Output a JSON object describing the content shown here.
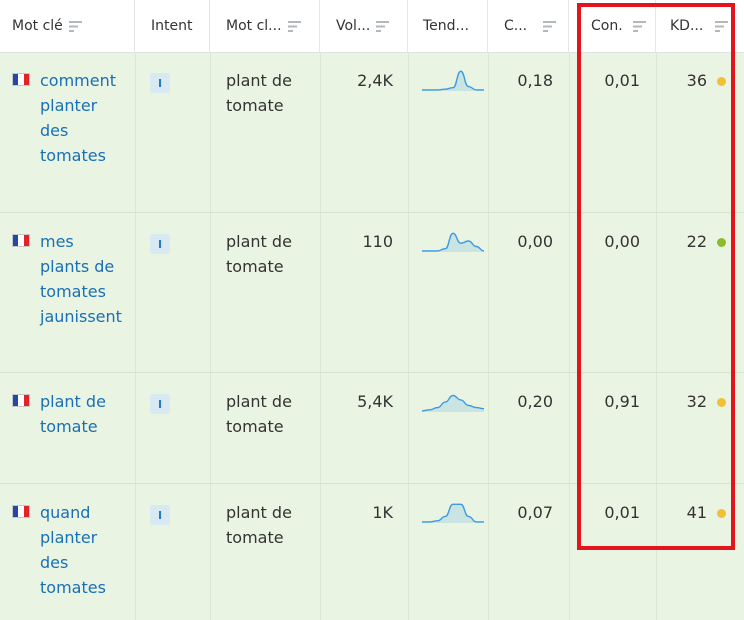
{
  "headers": {
    "keyword": "Mot clé",
    "intent": "Intent",
    "main_keyword": "Mot cl...",
    "volume": "Vol...",
    "trend": "Tend...",
    "cpc": "C...",
    "competition": "Con.",
    "kd": "KD..."
  },
  "colors": {
    "highlight": "#e3141c",
    "link": "#1a6fb5",
    "kd_yellow": "#f2c037",
    "kd_green": "#8dbb2a",
    "sparkline": "#3b9ae6",
    "row_bg": "#e9f4e2"
  },
  "rows": [
    {
      "keyword_lines": [
        "comment",
        "planter",
        "des",
        "tomates"
      ],
      "intent": "I",
      "main_keyword_lines": [
        "plant de",
        "tomate"
      ],
      "volume": "2,4K",
      "trend": [
        0.05,
        0.05,
        0.05,
        0.08,
        0.15,
        0.9,
        0.2,
        0.05,
        0.05
      ],
      "cpc": "0,18",
      "competition": "0,01",
      "kd": "36",
      "kd_color": "yellow",
      "flag": "france-flag-icon"
    },
    {
      "keyword_lines": [
        "mes",
        "plants de",
        "tomates",
        "jaunissent"
      ],
      "intent": "I",
      "main_keyword_lines": [
        "plant de",
        "tomate"
      ],
      "volume": "110",
      "trend": [
        0.05,
        0.05,
        0.05,
        0.15,
        0.85,
        0.4,
        0.5,
        0.25,
        0.05
      ],
      "cpc": "0,00",
      "competition": "0,00",
      "kd": "22",
      "kd_color": "green",
      "flag": "france-flag-icon"
    },
    {
      "keyword_lines": [
        "plant de",
        "tomate"
      ],
      "intent": "I",
      "main_keyword_lines": [
        "plant de",
        "tomate"
      ],
      "volume": "5,4K",
      "trend": [
        0.05,
        0.1,
        0.2,
        0.45,
        0.75,
        0.55,
        0.3,
        0.2,
        0.15
      ],
      "cpc": "0,20",
      "competition": "0,91",
      "kd": "32",
      "kd_color": "yellow",
      "flag": "france-flag-icon"
    },
    {
      "keyword_lines": [
        "quand",
        "planter",
        "des",
        "tomates"
      ],
      "intent": "I",
      "main_keyword_lines": [
        "plant de",
        "tomate"
      ],
      "volume": "1K",
      "trend": [
        0.05,
        0.05,
        0.1,
        0.3,
        0.85,
        0.85,
        0.3,
        0.05,
        0.05
      ],
      "cpc": "0,07",
      "competition": "0,01",
      "kd": "41",
      "kd_color": "yellow",
      "flag": "france-flag-icon"
    }
  ]
}
